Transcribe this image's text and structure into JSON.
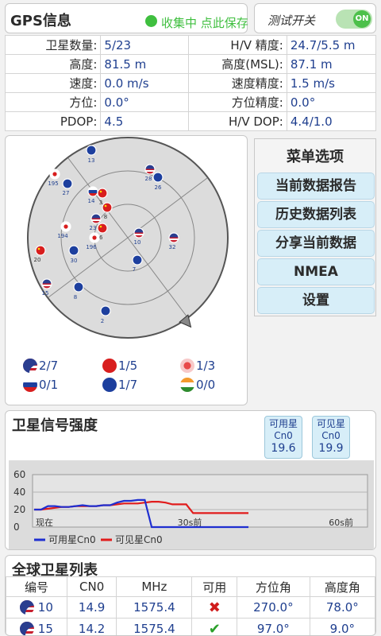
{
  "gps": {
    "title": "GPS信息",
    "status": "收集中 点此保存",
    "status_color": "#3fbf3f",
    "rows": [
      {
        "l1": "卫星数量:",
        "v1": "5/23",
        "l2": "H/V 精度:",
        "v2": "24.7/5.5 m"
      },
      {
        "l1": "高度:",
        "v1": "81.5 m",
        "l2": "高度(MSL):",
        "v2": "87.1 m"
      },
      {
        "l1": "速度:",
        "v1": "0.0 m/s",
        "l2": "速度精度:",
        "v2": "1.5 m/s"
      },
      {
        "l1": "方位:",
        "v1": "0.0°",
        "l2": "方位精度:",
        "v2": "0.0°"
      },
      {
        "l1": "PDOP:",
        "v1": "4.5",
        "l2": "H/V DOP:",
        "v2": "4.4/1.0"
      }
    ]
  },
  "test": {
    "label": "测试开关",
    "toggle": "ON",
    "on": true
  },
  "sky": {
    "satellites": [
      {
        "id": "13",
        "type": "eu"
      },
      {
        "id": "195",
        "type": "jp"
      },
      {
        "id": "27",
        "type": "eu"
      },
      {
        "id": "14",
        "type": "ru"
      },
      {
        "id": "3",
        "type": "cn"
      },
      {
        "id": "28",
        "type": "us"
      },
      {
        "id": "26",
        "type": "eu"
      },
      {
        "id": "8",
        "type": "cn"
      },
      {
        "id": "23",
        "type": "us"
      },
      {
        "id": "194",
        "type": "jp"
      },
      {
        "id": "36",
        "type": "cn"
      },
      {
        "id": "196",
        "type": "jp"
      },
      {
        "id": "10",
        "type": "us"
      },
      {
        "id": "32",
        "type": "us"
      },
      {
        "id": "20",
        "type": "cn"
      },
      {
        "id": "30",
        "type": "eu"
      },
      {
        "id": "7",
        "type": "eu"
      },
      {
        "id": "15",
        "type": "us"
      },
      {
        "id": "8",
        "type": "eu"
      },
      {
        "id": "2",
        "type": "eu"
      }
    ],
    "legend": [
      {
        "type": "us",
        "value": "2/7"
      },
      {
        "type": "cn",
        "value": "1/5"
      },
      {
        "type": "jp",
        "value": "1/3"
      },
      {
        "type": "ru",
        "value": "0/1"
      },
      {
        "type": "eu",
        "value": "1/7"
      },
      {
        "type": "in",
        "value": "0/0"
      }
    ]
  },
  "menu": {
    "title": "菜单选项",
    "items": [
      "当前数据报告",
      "历史数据列表",
      "分享当前数据",
      "NMEA",
      "设置"
    ]
  },
  "signal": {
    "title": "卫星信号强度",
    "boxes": [
      {
        "label": "可用星",
        "sub": "Cn0",
        "value": "19.6"
      },
      {
        "label": "可见星",
        "sub": "Cn0",
        "value": "19.9"
      }
    ]
  },
  "chart_data": {
    "type": "line",
    "ylim": [
      0,
      60
    ],
    "yticks": [
      "0",
      "20",
      "40",
      "60"
    ],
    "x_labels": [
      "现在",
      "30s前",
      "60s前"
    ],
    "grid": true,
    "legend_position": "bottom-left",
    "series": [
      {
        "name": "可用星Cn0",
        "color": "#1f2fd0",
        "values": [
          20,
          20,
          24,
          24,
          23,
          23,
          24,
          25,
          24,
          24,
          25,
          25,
          28,
          30,
          30,
          31,
          31,
          0,
          0,
          0,
          0,
          0,
          0,
          0,
          0,
          0,
          0,
          0,
          0,
          0,
          0,
          0
        ]
      },
      {
        "name": "可见星Cn0",
        "color": "#e11c1c",
        "values": [
          20,
          20,
          21,
          22,
          23,
          23,
          24,
          24,
          24,
          24,
          25,
          25,
          26,
          27,
          27,
          27,
          28,
          29,
          29,
          28,
          26,
          26,
          26,
          16,
          16,
          16,
          16,
          16,
          16,
          16,
          16,
          16
        ]
      }
    ]
  },
  "list": {
    "title": "全球卫星列表",
    "headers": [
      "编号",
      "CN0",
      "MHz",
      "可用",
      "方位角",
      "高度角"
    ],
    "rows": [
      {
        "id": "10",
        "cn0": "14.9",
        "mhz": "1575.4",
        "used": false,
        "az": "270.0°",
        "el": "78.0°"
      },
      {
        "id": "15",
        "cn0": "14.2",
        "mhz": "1575.4",
        "used": true,
        "az": "97.0°",
        "el": "9.0°"
      }
    ]
  },
  "colors": {
    "accent": "#3fbf3f",
    "text_blue": "#1f3f8f",
    "button_bg": "#d7eef8"
  }
}
